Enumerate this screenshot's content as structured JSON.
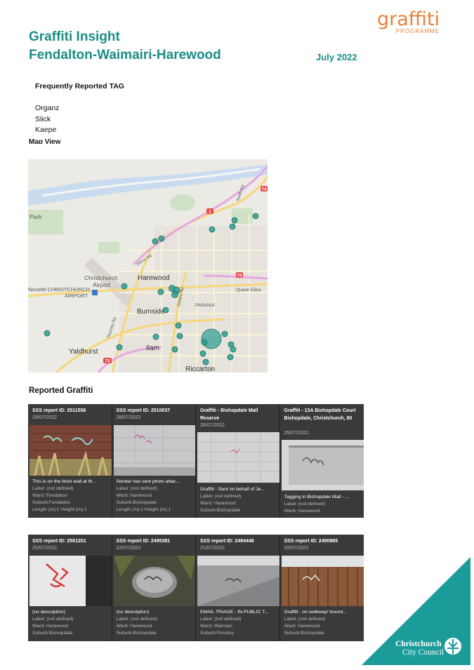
{
  "header": {
    "title_line1": "Graffiti Insight",
    "title_line2": "Fendalton-Waimairi-Harewood",
    "date": "July 2022",
    "logo_main": "graffiti",
    "logo_sub": "PROGRAMME"
  },
  "frequent_tags": {
    "heading": "Frequently Reported TAG",
    "items": [
      "Organz",
      "Slick",
      "Kaepe"
    ]
  },
  "map_section": {
    "heading": "Map View",
    "labels": {
      "christchurch_airport_l1": "Christchurch",
      "christchurch_airport_l2": "Airport",
      "harewood": "Harewood",
      "novotel": "Novotel CHRISTCHURCH",
      "airport": "AIRPORT",
      "burnside": "Burnside",
      "papanui": "PAPANUI",
      "yaldhurst": "Yaldhurst",
      "ilam": "Ilam",
      "riccarton": "Riccarton",
      "park": "Park",
      "johns_rd": "Johns Rd",
      "queen_eliza": "Queen Eliza",
      "north_rd": "North Rd",
      "russley_rd": "Russley Rd",
      "greers_rd": "Greers Rd",
      "shield_1": "1",
      "shield_74": "74",
      "shield_73": "73",
      "shield_74b": "74"
    }
  },
  "reported": {
    "heading": "Reported Graffiti",
    "row1": [
      {
        "title": "SSS report ID: 2511558",
        "date": "29/07/2022",
        "desc": "This is on the brick wall at th...",
        "label": "Label: (not defined)",
        "ward": "Ward: Fendalton",
        "suburb": "Suburb:Fendalton",
        "extra": "Length (m):1 Height (m):1"
      },
      {
        "title": "SSS report ID: 2510037",
        "date": "28/07/2022",
        "desc": "Sender has sent photo attac...",
        "label": "Label: (not defined)",
        "ward": "Ward: Harewood",
        "suburb": "Suburb:Bishopdale",
        "extra": "Length (m):1 Height (m):1"
      },
      {
        "title": "Graffiti - Bishopdale Mall Reserve",
        "date": "26/07/2022",
        "desc": "Graffiti - Sent on behalf of Je...",
        "label": "Label: (not defined)",
        "ward": "Ward: Harewood",
        "suburb": "Suburb:Bishopdale",
        "extra": ""
      },
      {
        "title": "Graffiti - 13A Bishopdale Court Bishopdale, Christchurch, 80",
        "date": "25/07/2022",
        "desc": "Tagging in Bishopdale Mall - ...",
        "label": "Label: (not defined)",
        "ward": "Ward: Harewood",
        "suburb": "",
        "extra": ""
      }
    ],
    "row2": [
      {
        "title": "SSS report ID: 2501201",
        "date": "25/07/2022",
        "desc": "(no description)",
        "label": "Label: (not defined)",
        "ward": "Ward: Harewood",
        "suburb": "Suburb:Bishopdale"
      },
      {
        "title": "SSS report ID: 2495381",
        "date": "22/07/2022",
        "desc": "(no description)",
        "label": "Label: (not defined)",
        "ward": "Ward: Harewood",
        "suburb": "Suburb:Bishopdale"
      },
      {
        "title": "SSS report ID: 2494448",
        "date": "21/07/2022",
        "desc": "EMAIL TRIAGE - IN PUBLIC T...",
        "label": "Label: (not defined)",
        "ward": "Ward: Waimairi",
        "suburb": "Suburb:Russley"
      },
      {
        "title": "SSS report ID: 2490965",
        "date": "20/07/2022",
        "desc": "Graffiti - on walkway/ bound...",
        "label": "Label: (not defined)",
        "ward": "Ward: Harewood",
        "suburb": "Suburb:Bishopdale"
      }
    ]
  },
  "footer": {
    "council_l1": "Christchurch",
    "council_l2": "City Council"
  },
  "colors": {
    "brand_teal": "#1b8d86",
    "logo_orange": "#e8823a",
    "marker": "#2a9d8f"
  }
}
